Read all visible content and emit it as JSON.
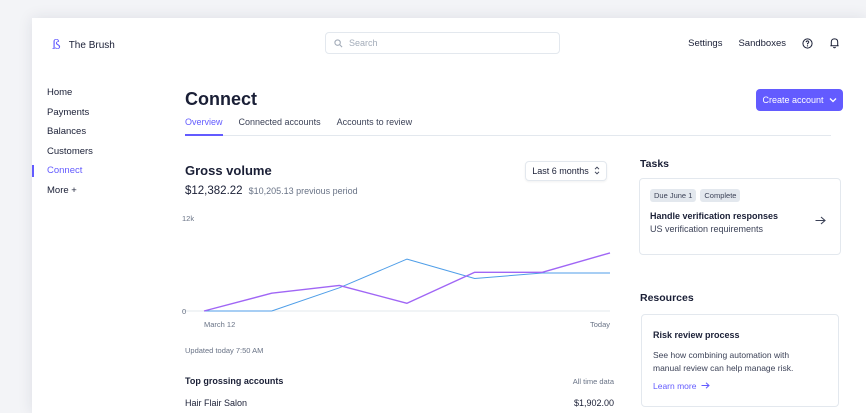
{
  "app": {
    "name": "The Brush",
    "logo": "ß"
  },
  "search": {
    "placeholder": "Search"
  },
  "topnav": {
    "settings": "Settings",
    "sandboxes": "Sandboxes"
  },
  "sidebar": {
    "items": [
      {
        "label": "Home"
      },
      {
        "label": "Payments"
      },
      {
        "label": "Balances"
      },
      {
        "label": "Customers"
      },
      {
        "label": "Connect",
        "active": true
      },
      {
        "label": "More +"
      }
    ]
  },
  "page": {
    "title": "Connect",
    "create_button": "Create account",
    "tabs": [
      {
        "label": "Overview",
        "active": true
      },
      {
        "label": "Connected accounts"
      },
      {
        "label": "Accounts to review"
      }
    ]
  },
  "gross": {
    "title": "Gross volume",
    "value": "$12,382.22",
    "previous": "$10,205.13 previous period",
    "range": "Last 6 months",
    "updated": "Updated today 7:50 AM"
  },
  "chart_data": {
    "type": "line",
    "y_ticks": [
      "12k",
      "0"
    ],
    "x_labels": [
      "March 12",
      "Today"
    ],
    "ylim": [
      0,
      12000
    ],
    "series": [
      {
        "values": [
          0,
          0,
          3000,
          6700,
          4200,
          4900,
          4900
        ],
        "color": "#4f9ee8"
      },
      {
        "values": [
          0,
          2300,
          3300,
          1000,
          5000,
          5000,
          7500
        ],
        "color": "#a066f5"
      }
    ]
  },
  "top_accounts": {
    "title": "Top grossing accounts",
    "range": "All time data",
    "rows": [
      {
        "name": "Hair Flair Salon",
        "amount": "$1,902.00"
      }
    ]
  },
  "tasks": {
    "title": "Tasks",
    "badges": [
      "Due June 1",
      "Complete"
    ],
    "item_title": "Handle verification responses",
    "item_sub": "US verification requirements"
  },
  "resources": {
    "title": "Resources",
    "card_title": "Risk review process",
    "card_desc_1": "See how combining automation with",
    "card_desc_2": "manual review can help manage risk.",
    "link": "Learn more"
  },
  "colors": {
    "accent": "#635bff",
    "series_blue": "#4f9ee8",
    "series_purple": "#a066f5"
  }
}
